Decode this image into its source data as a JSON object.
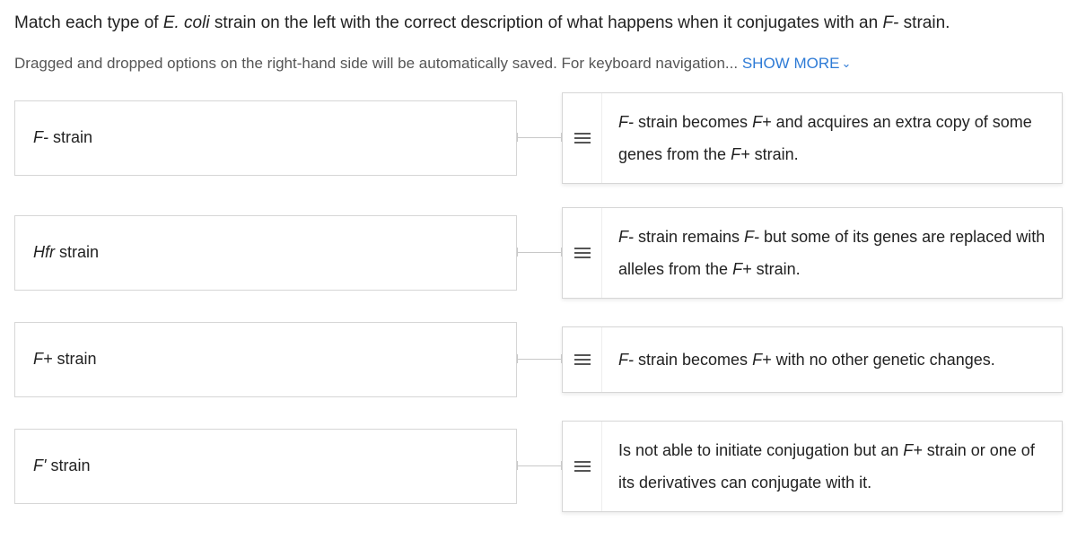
{
  "question": {
    "pre": "Match each type of ",
    "em1": "E. coli",
    "mid": " strain on the left with the correct description of what happens when it conjugates with an ",
    "em2": "F-",
    "post": " strain."
  },
  "instructions": {
    "text": "Dragged and dropped options on the right-hand side will be automatically saved. For keyboard navigation...",
    "show_more": "SHOW MORE"
  },
  "rows": [
    {
      "left_em": "F-",
      "left_rest": " strain",
      "right_em1": "F-",
      "right_mid1": " strain becomes ",
      "right_em2": "F+",
      "right_mid2": " and acquires an extra copy of some  genes from the ",
      "right_em3": "F+",
      "right_post": " strain."
    },
    {
      "left_em": "Hfr",
      "left_rest": " strain",
      "right_em1": "F-",
      "right_mid1": " strain remains ",
      "right_em2": "F-",
      "right_mid2": " but some of its genes are replaced with  alleles from the ",
      "right_em3": "F+",
      "right_post": " strain."
    },
    {
      "left_em": "F+",
      "left_rest": " strain",
      "right_em1": "F-",
      "right_mid1": " strain becomes ",
      "right_em2": "F+",
      "right_mid2": " with no other genetic changes.",
      "right_em3": "",
      "right_post": ""
    },
    {
      "left_em": "F'",
      "left_rest": " strain",
      "right_em1": "",
      "right_mid1": "Is not able to initiate conjugation but an ",
      "right_em2": "F+",
      "right_mid2": "  strain or one of its  derivatives can conjugate with it.",
      "right_em3": "",
      "right_post": ""
    }
  ]
}
